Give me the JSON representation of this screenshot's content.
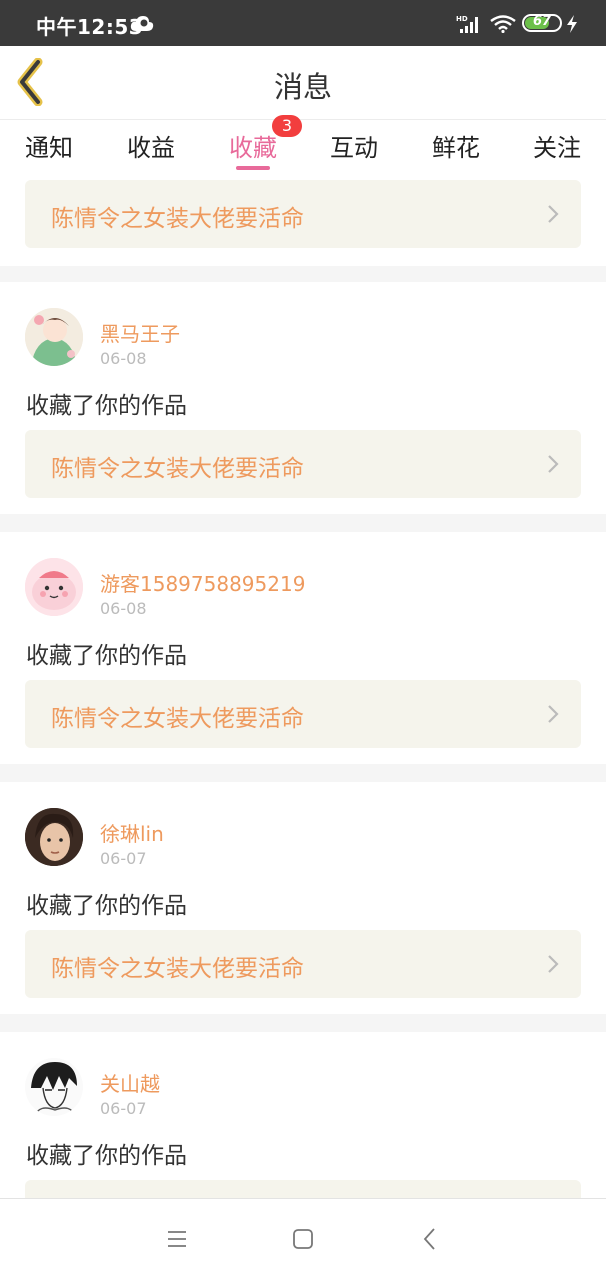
{
  "status_bar": {
    "time": "中午12:53",
    "network": "HD",
    "battery": "67",
    "battery_level": 0.67,
    "icons": [
      "cloud-icon",
      "signal-icon",
      "wifi-icon",
      "battery-icon",
      "charging-bolt-icon"
    ]
  },
  "header": {
    "title": "消息",
    "back_icon": "chevron-left-icon"
  },
  "tabs": [
    {
      "label": "通知"
    },
    {
      "label": "收益"
    },
    {
      "label": "收藏",
      "active": true,
      "badge": "3"
    },
    {
      "label": "互动"
    },
    {
      "label": "鲜花"
    },
    {
      "label": "关注"
    }
  ],
  "colors": {
    "accent": "#e86a9a",
    "badge": "#f23e3e",
    "username": "#ee9a5e",
    "work_bg": "#f5f4ec"
  },
  "feed": {
    "first_work": "陈情令之女装大佬要活命",
    "messages": [
      {
        "user": "黑马王子",
        "date": "06-08",
        "text": "收藏了你的作品",
        "work": "陈情令之女装大佬要活命"
      },
      {
        "user": "游客1589758895219",
        "date": "06-08",
        "text": "收藏了你的作品",
        "work": "陈情令之女装大佬要活命"
      },
      {
        "user": "徐琳lin",
        "date": "06-07",
        "text": "收藏了你的作品",
        "work": "陈情令之女装大佬要活命"
      },
      {
        "user": "关山越",
        "date": "06-07",
        "text": "收藏了你的作品"
      }
    ]
  },
  "nav_bar": {
    "icons": [
      "menu-icon",
      "home-icon",
      "back-icon"
    ]
  }
}
